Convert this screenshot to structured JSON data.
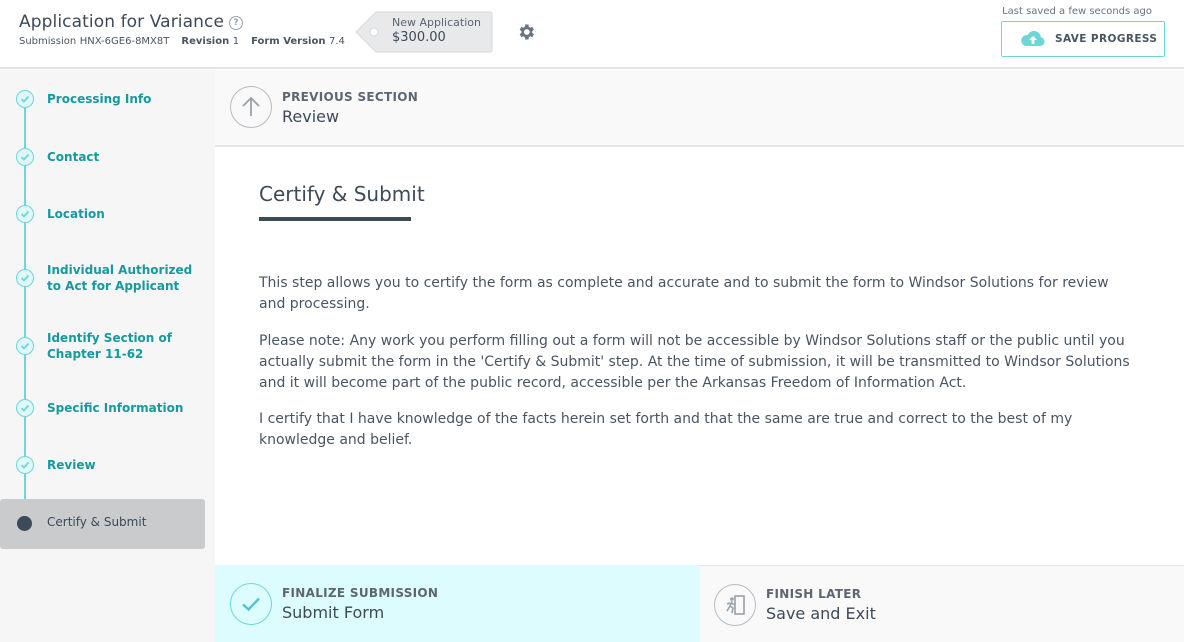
{
  "header": {
    "title": "Application for Variance",
    "help_icon": "question-circle-icon",
    "submission_label": "Submission",
    "submission_id": "HNX-6GE6-8MX8T",
    "revision_label": "Revision",
    "revision_value": "1",
    "form_version_label": "Form Version",
    "form_version_value": "7.4",
    "tag_label": "New Application",
    "tag_price": "$300.00",
    "settings_icon": "gear-icon",
    "last_saved": "Last saved a few seconds ago",
    "save_button_label": "SAVE PROGRESS",
    "save_icon": "cloud-upload-icon"
  },
  "sidebar": {
    "items": [
      {
        "label_line1": "Processing Info",
        "label_line2": "",
        "status": "complete"
      },
      {
        "label_line1": "Contact",
        "label_line2": "",
        "status": "complete"
      },
      {
        "label_line1": "Location",
        "label_line2": "",
        "status": "complete"
      },
      {
        "label_line1": "Individual Authorized",
        "label_line2": "to Act for Applicant",
        "status": "complete"
      },
      {
        "label_line1": "Identify Section of",
        "label_line2": "Chapter 11-62",
        "status": "complete"
      },
      {
        "label_line1": "Specific Information",
        "label_line2": "",
        "status": "complete"
      },
      {
        "label_line1": "Review",
        "label_line2": "",
        "status": "complete"
      },
      {
        "label_line1": "Certify & Submit",
        "label_line2": "",
        "status": "current"
      }
    ]
  },
  "prev_section": {
    "kicker": "PREVIOUS SECTION",
    "name": "Review",
    "icon": "arrow-up-icon"
  },
  "main": {
    "title": "Certify & Submit",
    "paragraphs": [
      "This step allows you to certify the form as complete and accurate and to submit the form to Windsor Solutions for review and processing.",
      "Please note: Any work you perform filling out a form will not be accessible by Windsor Solutions staff or the public until you actually submit the form in the 'Certify & Submit' step. At the time of submission, it will be transmitted to Windsor Solutions and it will become part of the public record, accessible per the Arkansas Freedom of Information Act.",
      "I certify that I have knowledge of the facts herein set forth and that the same are true and correct to the best of my knowledge and belief."
    ]
  },
  "footer": {
    "finalize_kicker": "FINALIZE SUBMISSION",
    "finalize_label": "Submit Form",
    "finalize_icon": "checkmark-icon",
    "finish_kicker": "FINISH LATER",
    "finish_label": "Save and Exit",
    "finish_icon": "exit-door-icon"
  },
  "colors": {
    "accent": "#6fd6d8",
    "accent_text": "#17999e",
    "text_dark": "#3d4a57",
    "active_bg": "#c9cbcd",
    "finalize_bg": "#dcfcfd"
  }
}
